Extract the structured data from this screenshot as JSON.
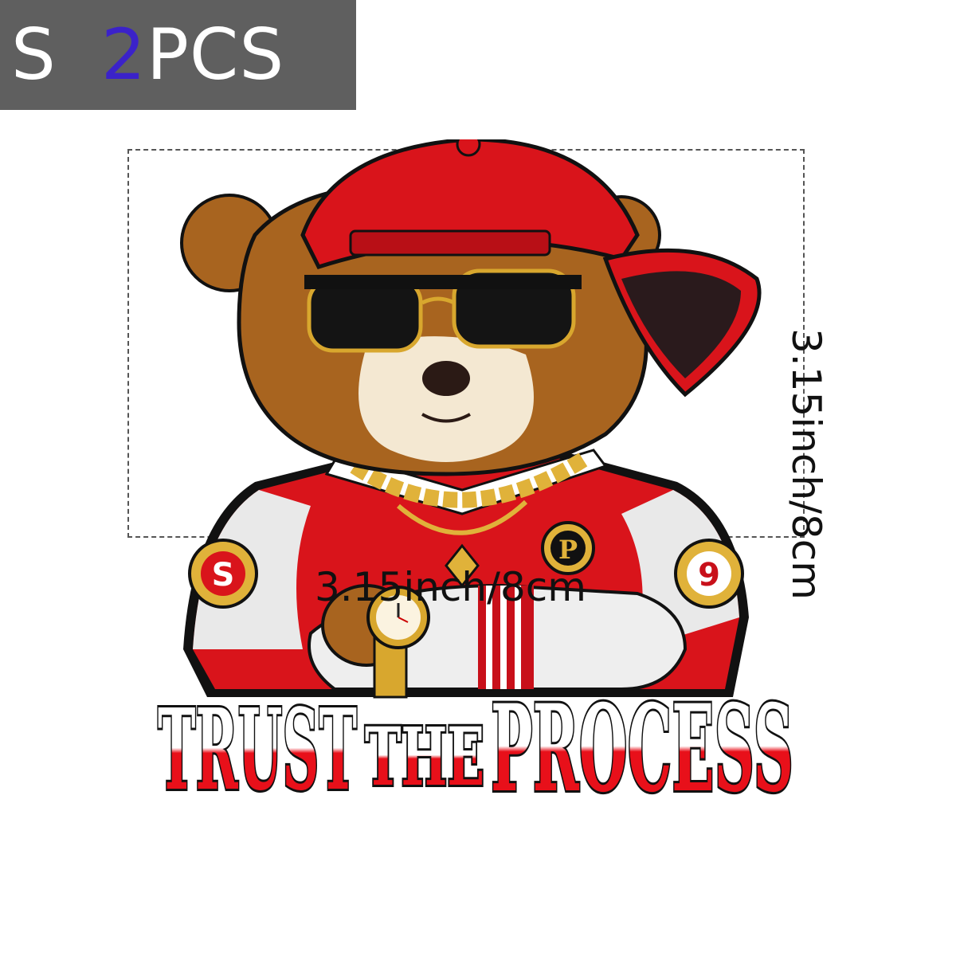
{
  "badge": {
    "size": "S",
    "count": "2",
    "unit": "PCS"
  },
  "sticker": {
    "slogan_word_1": "TRUST",
    "slogan_word_2": "THE",
    "slogan_word_3": "PROCESS",
    "left_sleeve_patch": "S",
    "right_sleeve_patch": "9",
    "chest_patch": "P"
  },
  "dimensions": {
    "width_label": "3.15inch/8cm",
    "height_label": "3.15inch/8cm"
  },
  "colors": {
    "badge_bg": "#5f5f5f",
    "badge_count": "#3b22c9",
    "jacket_red": "#d9141b",
    "fur_brown": "#9a5a1e",
    "gold": "#e0b23a"
  }
}
